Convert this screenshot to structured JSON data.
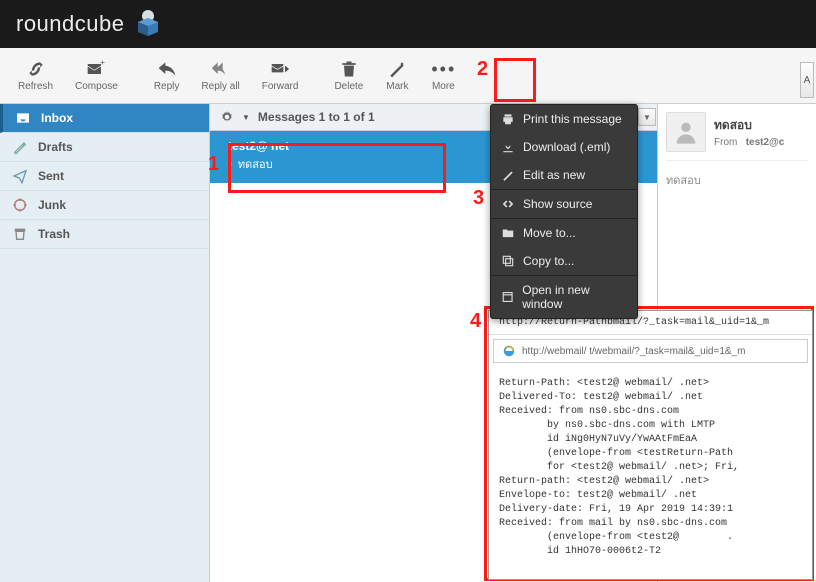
{
  "app_name": "roundcube",
  "toolbar": {
    "refresh": "Refresh",
    "compose": "Compose",
    "reply": "Reply",
    "reply_all": "Reply all",
    "forward": "Forward",
    "delete": "Delete",
    "mark": "Mark",
    "more": "More"
  },
  "folders": {
    "inbox": "Inbox",
    "drafts": "Drafts",
    "sent": "Sent",
    "junk": "Junk",
    "trash": "Trash"
  },
  "list_header": "Messages 1 to 1 of 1",
  "message": {
    "from_line": "test2@            net",
    "subject": "ทดสอบ"
  },
  "preview": {
    "name": "ทดสอบ",
    "from_label": "From",
    "from_value": "test2@c",
    "subject": "ทดสอบ"
  },
  "annotations": {
    "a1": "1",
    "a2": "2",
    "a3": "3",
    "a4": "4"
  },
  "menu": {
    "print": "Print this message",
    "download": "Download (.eml)",
    "edit": "Edit as new",
    "source": "Show source",
    "move": "Move to...",
    "copy": "Copy to...",
    "newwin": "Open in new window"
  },
  "source": {
    "title": "http://Return-Pathbmail/?_task=mail&_uid=1&_m",
    "addr": "http://webmail/  t/webmail/?_task=mail&_uid=1&_m",
    "body": "Return-Path: <test2@ webmail/ .net>\nDelivered-To: test2@ webmail/ .net\nReceived: from ns0.sbc-dns.com\n        by ns0.sbc-dns.com with LMTP\n        id iNg0HyN7uVy/YwAAtFmEaA\n        (envelope-from <testReturn-Path\n        for <test2@ webmail/ .net>; Fri,\nReturn-path: <test2@ webmail/ .net>\nEnvelope-to: test2@ webmail/ .net\nDelivery-date: Fri, 19 Apr 2019 14:39:1\nReceived: from mail by ns0.sbc-dns.com \n        (envelope-from <test2@        .\n        id 1hHO70-0006t2-T2"
  }
}
